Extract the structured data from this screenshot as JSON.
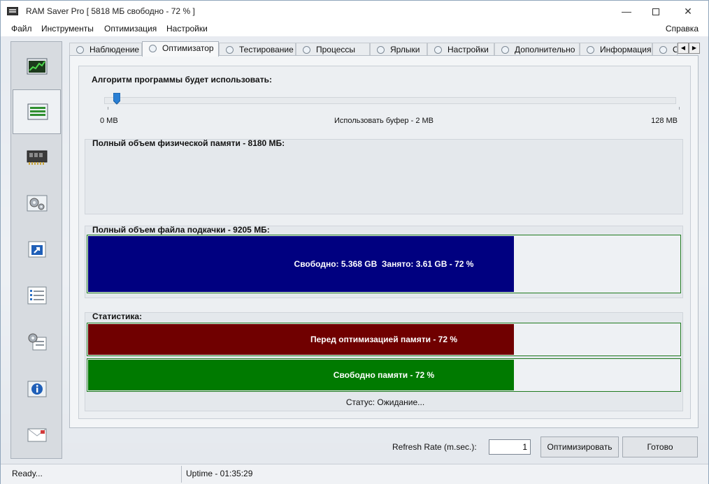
{
  "window": {
    "title": "RAM Saver Pro [ 5818 МБ свободно - 72 % ]",
    "controls": {
      "minimize": "—",
      "close": "✕"
    }
  },
  "menu": {
    "items": [
      "Файл",
      "Инструменты",
      "Оптимизация",
      "Настройки"
    ],
    "help": "Справка"
  },
  "sidebar": {
    "buttons": [
      {
        "icon": "monitor-chart-icon",
        "active": false
      },
      {
        "icon": "optimizer-list-icon",
        "active": true
      },
      {
        "icon": "memory-chip-icon",
        "active": false
      },
      {
        "icon": "gears-icon",
        "active": false
      },
      {
        "icon": "shortcut-arrow-icon",
        "active": false
      },
      {
        "icon": "checklist-icon",
        "active": false
      },
      {
        "icon": "gear-checklist-icon",
        "active": false
      },
      {
        "icon": "info-icon",
        "active": false
      },
      {
        "icon": "mail-icon",
        "active": false
      }
    ]
  },
  "tabs": {
    "items": [
      "Наблюдение",
      "Оптимизатор",
      "Тестирование",
      "Процессы",
      "Ярлыки",
      "Настройки",
      "Дополнительно",
      "Информация",
      "О"
    ],
    "active": "Оптимизатор",
    "scroll_left": "◀",
    "scroll_right": "▶"
  },
  "algorithm": {
    "title": "Алгоритм программы будет использовать:",
    "min_label": "0 MB",
    "buffer_label": "Использовать буфер - 2 MB",
    "max_label": "128 MB",
    "buffer_mb": 2,
    "max_mb": 128
  },
  "physical": {
    "title": "Полный объем физической памяти - 8180 МБ:"
  },
  "pagefile": {
    "title": "Полный объем файла подкачки - 9205 МБ:",
    "bar_text": "Свободно: 5.368 GB  Занято: 3.61 GB - 72 %",
    "fill_percent": 72,
    "color": "#000080"
  },
  "stats": {
    "title": "Статистика:",
    "before_text": "Перед оптимизацией памяти - 72 %",
    "before_percent": 72,
    "before_color": "#700000",
    "free_text": "Свободно памяти - 72 %",
    "free_percent": 72,
    "free_color": "#007a00",
    "status": "Статус: Ожидание..."
  },
  "controls": {
    "refresh_label": "Refresh Rate (m.sec.):",
    "refresh_value": "1",
    "optimize_label": "Оптимизировать",
    "done_label": "Готово"
  },
  "statusbar": {
    "ready": "Ready...",
    "uptime": "Uptime - 01:35:29"
  }
}
